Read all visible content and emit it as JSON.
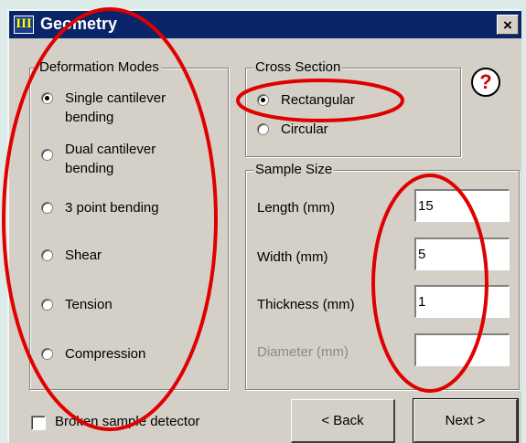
{
  "window": {
    "title": "Geometry",
    "app_icon_glyph": "III",
    "close_glyph": "×"
  },
  "deformation_modes": {
    "legend": "Deformation Modes",
    "options": [
      {
        "label_line1": "Single cantilever",
        "label_line2": "bending",
        "selected": true
      },
      {
        "label_line1": "Dual cantilever",
        "label_line2": "bending",
        "selected": false
      },
      {
        "label_line1": "3 point bending",
        "label_line2": "",
        "selected": false
      },
      {
        "label_line1": "Shear",
        "label_line2": "",
        "selected": false
      },
      {
        "label_line1": "Tension",
        "label_line2": "",
        "selected": false
      },
      {
        "label_line1": "Compression",
        "label_line2": "",
        "selected": false
      }
    ]
  },
  "cross_section": {
    "legend": "Cross Section",
    "options": [
      {
        "label": "Rectangular",
        "selected": true
      },
      {
        "label": "Circular",
        "selected": false
      }
    ]
  },
  "help": {
    "glyph": "?"
  },
  "sample_size": {
    "legend": "Sample Size",
    "fields": [
      {
        "label": "Length (mm)",
        "value": "15",
        "enabled": true
      },
      {
        "label": "Width (mm)",
        "value": "5",
        "enabled": true
      },
      {
        "label": "Thickness (mm)",
        "value": "1",
        "enabled": true
      },
      {
        "label": "Diameter (mm)",
        "value": "",
        "enabled": false
      }
    ]
  },
  "footer": {
    "checkbox_label": "Broken sample detector",
    "checkbox_checked": false,
    "back_label": "< Back",
    "next_label": "Next >"
  },
  "annotation_color": "#e00000"
}
